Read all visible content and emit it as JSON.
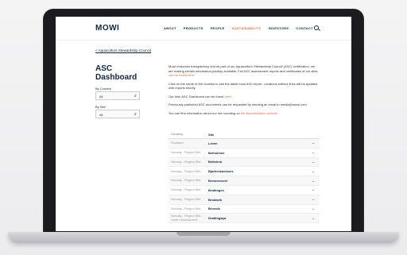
{
  "nav": {
    "logo": "MOWI",
    "items": [
      "ABOUT",
      "PRODUCTS",
      "PEOPLE",
      "SUSTAINABILITY",
      "INVESTORS",
      "CONTACT"
    ],
    "active_index": 3
  },
  "breadcrumb": "< Aquaculture Stewardship Council",
  "sidebar": {
    "title_line1": "ASC",
    "title_line2": "Dashboard",
    "filter_country_label": "By Country",
    "filter_country_value": "All",
    "filter_site_label": "By Site",
    "filter_site_value": "All"
  },
  "paragraphs": [
    {
      "text": "Mowi endorses transparency and as part of our Aquaculture Stewardship Council (ASC) certification, we are making certain information publicly available. Full ASC assessment reports and certificates of our sites ",
      "link": "can be found here"
    },
    {
      "text": "Click on the name of the location to see the latest local ASC report. Locations without links will be updates with reports shortly.",
      "link": ""
    },
    {
      "text": "Our Irish ASC Dashboard can be found ",
      "link": "here!"
    },
    {
      "text": "Previously published ASC documents can be requested by sending an email to media@mowi.com.",
      "link": ""
    },
    {
      "text": "You can find information about our lice counting on ",
      "link": "the BarentsWatch website."
    }
  ],
  "table": {
    "headers": [
      "Country",
      "Site"
    ],
    "rows": [
      {
        "country": "Scotland",
        "site": "Leven"
      },
      {
        "country": "Norway - Region Mid",
        "site": "Belholmen"
      },
      {
        "country": "Norway - Region Mid",
        "site": "Beitstrea"
      },
      {
        "country": "Norway - Region Mid",
        "site": "Bjørkeskavlsnes"
      },
      {
        "country": "Norway - Region Mid",
        "site": "Brenneesvet"
      },
      {
        "country": "Norway - Region Mid",
        "site": "Brattingen"
      },
      {
        "country": "Norway - Region Mid",
        "site": "Brodavik"
      },
      {
        "country": "Norway - Region Mid",
        "site": "Bruvoik"
      },
      {
        "country": "Norway - Region Mid - Under assessment",
        "site": "Drattingøya"
      }
    ]
  },
  "colors": {
    "brand": "#0e2746",
    "accent": "#ef6b3a"
  }
}
